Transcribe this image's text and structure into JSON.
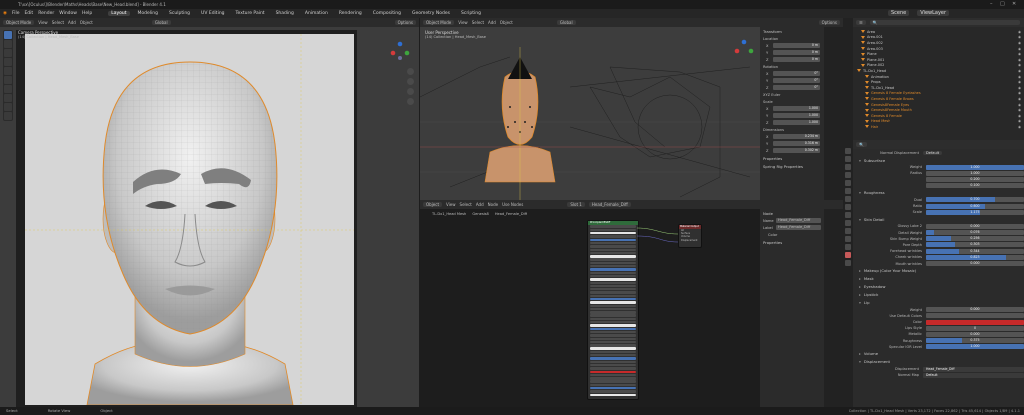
{
  "window": {
    "title": "T:\\xx\\[Oculus\\]\\Blender\\Maths\\Heads\\Base\\New_Head.blend] - Blender 4.1"
  },
  "menu": {
    "items": [
      "File",
      "Edit",
      "Render",
      "Window",
      "Help"
    ],
    "workspaces": [
      "Layout",
      "Modeling",
      "Sculpting",
      "UV Editing",
      "Texture Paint",
      "Shading",
      "Animation",
      "Rendering",
      "Compositing",
      "Geometry Nodes",
      "Scripting"
    ],
    "active_workspace": "Layout"
  },
  "scene_label": "Scene",
  "viewlayer_label": "ViewLayer",
  "left_viewport": {
    "mode": "Object Mode",
    "view": "View",
    "select": "Select",
    "add": "Add",
    "object": "Object",
    "orientation": "Global",
    "title": "Camera Perspective",
    "subtitle": "(14) Collection | Head_Mesh_Base",
    "options": "Options"
  },
  "right_viewport": {
    "mode": "Object Mode",
    "view": "View",
    "select": "Select",
    "add": "Add",
    "object": "Object",
    "orientation": "Global",
    "title": "User Perspective",
    "subtitle": "(14) Collection | Head_Mesh_Base",
    "options": "Options"
  },
  "n_panel": {
    "transform": "Transform",
    "location": "Location",
    "rotation": "Rotation",
    "scale": "Scale",
    "dimensions": "Dimensions",
    "loc_vals": [
      "0 m",
      "0 m",
      "0 m"
    ],
    "rot_vals": [
      "0°",
      "0°",
      "0°"
    ],
    "xyz_euler": "XYZ Euler",
    "scale_vals": [
      "1.000",
      "1.000",
      "1.000"
    ],
    "dim_vals": [
      "0.234 m",
      "0.316 m",
      "0.302 m"
    ],
    "properties": "Properties",
    "spring_rig": "Spring Rig Properties"
  },
  "node_editor": {
    "mode": "Object",
    "view": "View",
    "select": "Select",
    "add": "Add",
    "node": "Node",
    "use_nodes": "Use Nodes",
    "slot": "Slot 1",
    "material": "Head_Female_Diff",
    "breadcrumb": [
      "TL.Dx1_Head Mesh",
      "Genesis8",
      "Head_Female_Diff"
    ],
    "side_panel": {
      "tab": "Node",
      "name_label": "Name",
      "name_value": "Head_Female_Diff",
      "label_label": "Label",
      "label_value": "Head_Female_Diff",
      "color": "Color",
      "properties": "Properties"
    },
    "bsdf_title": "Principled BSDF",
    "output_title": "Material Output",
    "output_rows": [
      "All",
      "Surface",
      "Volume",
      "Displacement"
    ]
  },
  "outliner": {
    "items": [
      "Area",
      "Area.001",
      "Area.002",
      "Area.003",
      "Plane",
      "Plane.001",
      "Plane.002",
      "TL.Dx1_Head",
      "Animation",
      "Props",
      "TL.Dx1_Head",
      "Genesis 8 Female Eyelashes",
      "Genesis 8 Female Brows",
      "Genesis8Female Eyes",
      "Genesis8Female Mouth",
      "Genesis 8 Female",
      "Head Mesh",
      "Hair"
    ]
  },
  "properties": {
    "header": "Normal Displacement",
    "material_slot": "Default",
    "subsurface": "Subsurface",
    "subsurface_rows": [
      {
        "label": "Weight",
        "value": "1.000",
        "fill": 1.0
      },
      {
        "label": "Radius",
        "value": "1.000",
        "fill": 0
      },
      {
        "label": "",
        "value": "0.200",
        "fill": 0
      },
      {
        "label": "",
        "value": "0.100",
        "fill": 0
      }
    ],
    "roughness": "Roughness",
    "rough_rows": [
      {
        "label": "Dual",
        "value": "0.700",
        "fill": 0.7
      },
      {
        "label": "Ratio",
        "value": "0.600",
        "fill": 0.6
      },
      {
        "label": "Scale",
        "value": "1.175",
        "fill": 0.55
      }
    ],
    "skin_detail": "Skin Detail",
    "skin_rows": [
      {
        "label": "Glossy Lobe 2",
        "value": "0.000",
        "fill": 0
      },
      {
        "label": "Detail Weight",
        "value": "0.076",
        "fill": 0.08
      },
      {
        "label": "Skin Bump Weight",
        "value": "0.256",
        "fill": 0.26
      },
      {
        "label": "Pore Depth",
        "value": "0.303",
        "fill": 0.3
      },
      {
        "label": "Forehead wrinkles",
        "value": "0.344",
        "fill": 0.34
      },
      {
        "label": "Cheek wrinkles",
        "value": "0.823",
        "fill": 0.82
      },
      {
        "label": "Mouth wrinkles",
        "value": "0.000",
        "fill": 0
      }
    ],
    "collapsed_sections": [
      "Makeup (Color Your Mosaic)",
      "Mask",
      "Eyeshadow",
      "Lipstick"
    ],
    "lip": "Lip",
    "lip_rows": [
      {
        "label": "Weight",
        "value": "0.000",
        "fill": 0
      },
      {
        "label": "Use Default Colors",
        "value": "",
        "fill": 0
      },
      {
        "label": "Color",
        "value": "",
        "fill": 1.0,
        "color": "#c72a2a"
      },
      {
        "label": "Lips Style",
        "value": "0",
        "fill": 0
      },
      {
        "label": "Metallic",
        "value": "0.000",
        "fill": 0
      },
      {
        "label": "Roughness",
        "value": "0.375",
        "fill": 0.37
      },
      {
        "label": "Specular IOR Level",
        "value": "1.000",
        "fill": 1.0
      }
    ],
    "volume": "Volume",
    "displacement": "Displacement",
    "disp_rows": [
      {
        "label": "Displacement",
        "value": "Head_Female_Diff"
      },
      {
        "label": "Normal Map",
        "value": "Default"
      }
    ]
  },
  "status": {
    "left": [
      "Select",
      "Rotate View",
      "Object"
    ],
    "right": "Collection | TL.Dx1_Head Mesh | Verts 23,172 | Faces 22,862 | Tris 45,614 | Objects 1/89 | 4.1.1"
  },
  "colors": {
    "accent": "#4772b3",
    "viewport_bg": "#3e3e3e",
    "object_orange": "#e08a2a"
  }
}
